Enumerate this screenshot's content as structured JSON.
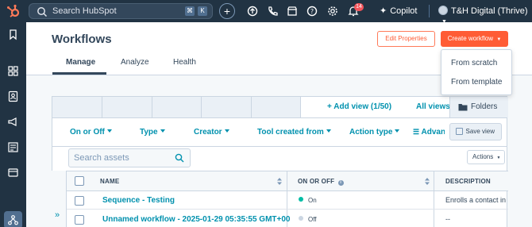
{
  "topbar": {
    "search_placeholder": "Search HubSpot",
    "shortcut_keys": [
      "⌘",
      "K"
    ],
    "add_label": "+",
    "notifications_count": "14",
    "copilot_label": "Copilot",
    "account_name": "T&H Digital (Thrive)"
  },
  "page": {
    "title": "Workflows",
    "edit_properties_label": "Edit Properties",
    "create_workflow_label": "Create workflow",
    "tabs": [
      "Manage",
      "Analyze",
      "Health"
    ]
  },
  "create_menu": {
    "items": [
      "From scratch",
      "From template"
    ]
  },
  "views_bar": {
    "add_view_label": "+ Add view (1/50)",
    "all_views_label": "All views",
    "folders_label": "Folders"
  },
  "filters": {
    "items": [
      "On or Off",
      "Type",
      "Creator",
      "Tool created from",
      "Action type",
      "Advan"
    ],
    "save_view_label": "Save view"
  },
  "toolbar": {
    "search_placeholder": "Search assets",
    "actions_label": "Actions"
  },
  "table": {
    "columns": [
      "NAME",
      "ON OR OFF",
      "DESCRIPTION"
    ],
    "rows": [
      {
        "name": "Sequence - Testing",
        "status": "On",
        "description": "Enrolls a contact in"
      },
      {
        "name": "Unnamed workflow - 2025-01-29 05:35:55 GMT+00",
        "status": "Off",
        "description": "--"
      }
    ]
  },
  "colors": {
    "topbar_bg": "#213343",
    "accent_orange": "#ff5c35",
    "link_teal": "#0091ae",
    "status_on": "#00bda5",
    "status_off": "#cbd6e2"
  }
}
